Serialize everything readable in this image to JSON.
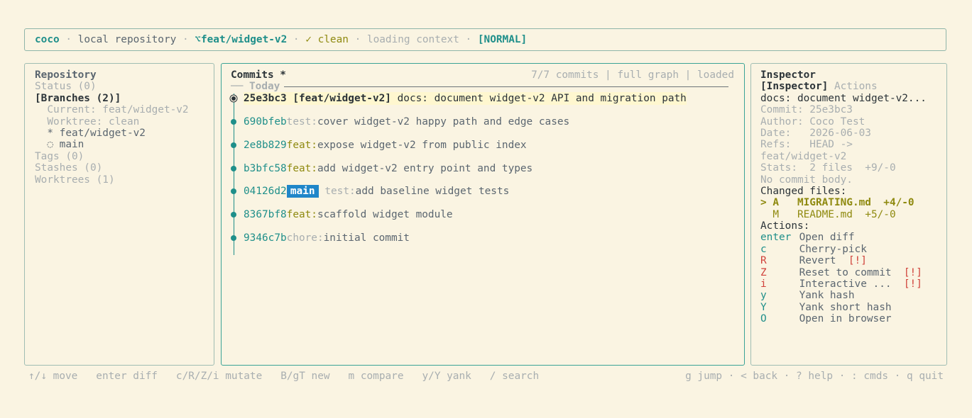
{
  "status_bar": {
    "app_name": "coco",
    "sep": " · ",
    "repo_label": "local repository",
    "branch_icon": "⌥",
    "branch": "feat/widget-v2",
    "clean_icon": "✓",
    "clean": "clean",
    "context": "loading context",
    "mode": "[NORMAL]"
  },
  "repository": {
    "title": "Repository",
    "status": "Status (0)",
    "branches": "[Branches (2)]",
    "current": "  Current: feat/widget-v2",
    "worktree": "  Worktree: clean",
    "branch_items": [
      {
        "marker": "  * ",
        "name": "feat/widget-v2"
      },
      {
        "marker": "  ◌ ",
        "name": "main"
      }
    ],
    "tags": "Tags (0)",
    "stashes": "Stashes (0)",
    "worktrees": "Worktrees (1)"
  },
  "commits": {
    "title": "Commits *",
    "meta": "7/7 commits | full graph | loaded",
    "group_label": "── Today",
    "rows": [
      {
        "hash": "25e3bc3",
        "ref": "[feat/widget-v2]",
        "type": "docs:",
        "subject": "document widget-v2 API and migration path"
      },
      {
        "hash": "690bfeb",
        "type": "test:",
        "subject": "cover widget-v2 happy path and edge cases"
      },
      {
        "hash": "2e8b829",
        "type": "feat:",
        "subject": "expose widget-v2 from public index"
      },
      {
        "hash": "b3bfc58",
        "type": "feat:",
        "subject": "add widget-v2 entry point and types"
      },
      {
        "hash": "04126d2",
        "badge": "main",
        "type": "test:",
        "subject": "add baseline widget tests"
      },
      {
        "hash": "8367bf8",
        "type": "feat:",
        "subject": "scaffold widget module"
      },
      {
        "hash": "9346c7b",
        "type": "chore:",
        "subject": "initial commit"
      }
    ]
  },
  "inspector": {
    "title": "Inspector",
    "tab_active": "[Inspector]",
    "tab_other": "Actions",
    "summary": "docs: document widget-v2...",
    "commit": "Commit: 25e3bc3",
    "author": "Author: Coco Test",
    "date": "Date:   2026-06-03",
    "refs1": "Refs:   HEAD ->",
    "refs2": "feat/widget-v2",
    "stats": "Stats:  2 files  +9/-0",
    "body": "No commit body.",
    "changed_title": "Changed files:",
    "files": [
      {
        "line": "> A   MIGRATING.md  +4/-0"
      },
      {
        "line": "  M   README.md  +5/-0"
      }
    ],
    "actions_title": "Actions:",
    "actions": [
      {
        "key": "enter",
        "label": "Open diff",
        "warn": ""
      },
      {
        "key": "c",
        "label": "Cherry-pick",
        "warn": ""
      },
      {
        "key": "R",
        "label": "Revert",
        "warn": "[!]"
      },
      {
        "key": "Z",
        "label": "Reset to commit",
        "warn": "[!]"
      },
      {
        "key": "i",
        "label": "Interactive ...",
        "warn": "[!]"
      },
      {
        "key": "y",
        "label": "Yank hash",
        "warn": ""
      },
      {
        "key": "Y",
        "label": "Yank short hash",
        "warn": ""
      },
      {
        "key": "O",
        "label": "Open in browser",
        "warn": ""
      }
    ]
  },
  "footer": {
    "left": "↑/↓ move   enter diff   c/R/Z/i mutate   B/gT new   m compare   y/Y yank   / search",
    "right": "g jump · < back · ? help · : cmds · q quit"
  },
  "colors": {
    "background": "#faf4e2",
    "accent_teal": "#1f8f8a",
    "olive": "#8f8a10",
    "badge_blue": "#1f86c9",
    "warn_red": "#d0413a"
  }
}
